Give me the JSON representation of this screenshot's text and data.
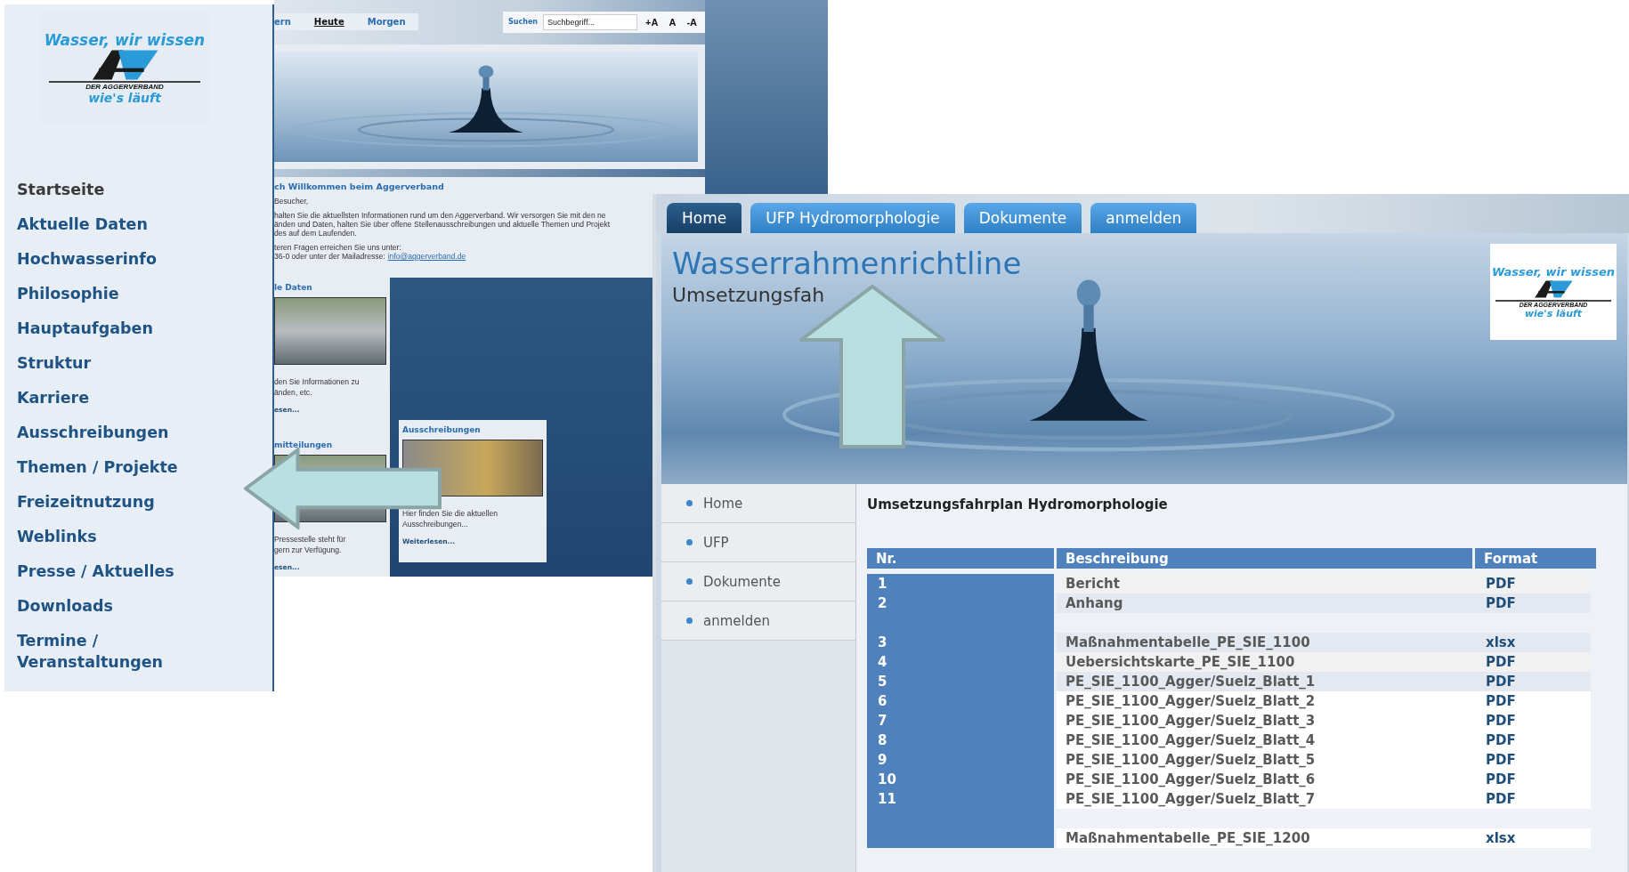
{
  "homepage": {
    "logo": {
      "top": "Wasser, wir wissen",
      "middle": "DER AGGERVERBAND",
      "bottom": "wie's läuft"
    },
    "nav": [
      {
        "label": "Startseite",
        "selected": true
      },
      {
        "label": "Aktuelle Daten",
        "selected": false
      },
      {
        "label": "Hochwasserinfo",
        "selected": false
      },
      {
        "label": "Philosophie",
        "selected": false
      },
      {
        "label": "Hauptaufgaben",
        "selected": false
      },
      {
        "label": "Struktur",
        "selected": false
      },
      {
        "label": "Karriere",
        "selected": false
      },
      {
        "label": "Ausschreibungen",
        "selected": false
      },
      {
        "label": "Themen / Projekte",
        "selected": false
      },
      {
        "label": "Freizeitnutzung",
        "selected": false
      },
      {
        "label": "Weblinks",
        "selected": false
      },
      {
        "label": "Presse / Aktuelles",
        "selected": false
      },
      {
        "label": "Downloads",
        "selected": false
      },
      {
        "label": "Termine / Veranstaltungen",
        "selected": false
      }
    ],
    "date_tabs": [
      {
        "label": "ern",
        "selected": false
      },
      {
        "label": "Heute",
        "selected": true
      },
      {
        "label": "Morgen",
        "selected": false
      }
    ],
    "search": {
      "label": "Suchen",
      "placeholder": "Suchbegriff..."
    },
    "font_size_buttons": [
      "+A",
      "A",
      "-A"
    ],
    "welcome": {
      "heading": "ch Willkommen beim Aggerverband",
      "greeting": "Besucher,",
      "lines": [
        "halten Sie die aktuellsten Informationen rund um den Aggerverband. Wir versorgen Sie mit den ne",
        "änden und Daten, halten Sie über offene Stellenausschreibungen und aktuelle Themen und Projekt",
        "des auf dem Laufenden."
      ],
      "contact": "teren Fragen erreichen Sie uns unter:",
      "contact_prefix": "36-0 oder unter der Mailadresse:",
      "email": "info@aggerverband.de"
    },
    "cards": [
      {
        "title": "le Daten",
        "lines": [
          "den Sie Informationen zu",
          "änden, etc."
        ],
        "link": "esen..."
      },
      {
        "title": "mitteilungen",
        "lines": [
          "Pressestelle steht für",
          "gern zur Verfügung."
        ],
        "link": "esen..."
      },
      {
        "title": "Ausschreibungen",
        "lines": [
          "Hier finden Sie die aktuellen",
          "Ausschreibungen..."
        ],
        "link": "Weiterlesen..."
      }
    ]
  },
  "ufp_page": {
    "tabs": [
      {
        "label": "Home",
        "selected": true
      },
      {
        "label": "UFP Hydromorphologie",
        "selected": false
      },
      {
        "label": "Dokumente",
        "selected": false
      },
      {
        "label": "anmelden",
        "selected": false
      }
    ],
    "title": "Wasserrahmenrichtline",
    "subtitle": "Umsetzungsfah",
    "logo": {
      "top": "Wasser, wir wissen",
      "middle": "DER AGGERVERBAND",
      "bottom": "wie's läuft"
    },
    "side_nav": [
      "Home",
      "UFP",
      "Dokumente",
      "anmelden"
    ],
    "heading": "Umsetzungsfahrplan Hydromorphologie",
    "table": {
      "columns": [
        "Nr.",
        "Beschreibung",
        "Format"
      ],
      "rows": [
        {
          "kind": "file",
          "nr": "1",
          "description": "Bericht",
          "format": "PDF"
        },
        {
          "kind": "file",
          "nr": "2",
          "description": "Anhang",
          "format": "PDF"
        },
        {
          "kind": "gap"
        },
        {
          "kind": "file",
          "nr": "3",
          "description": "Maßnahmentabelle_PE_SIE_1100",
          "format": "xlsx"
        },
        {
          "kind": "file",
          "nr": "4",
          "description": "Uebersichtskarte_PE_SIE_1100",
          "format": "PDF"
        },
        {
          "kind": "file",
          "nr": "5",
          "description": "PE_SIE_1100_Agger/Suelz_Blatt_1",
          "format": "PDF"
        },
        {
          "kind": "file",
          "nr": "6",
          "description": "PE_SIE_1100_Agger/Suelz_Blatt_2",
          "format": "PDF"
        },
        {
          "kind": "file",
          "nr": "7",
          "description": "PE_SIE_1100_Agger/Suelz_Blatt_3",
          "format": "PDF"
        },
        {
          "kind": "file",
          "nr": "8",
          "description": "PE_SIE_1100_Agger/Suelz_Blatt_4",
          "format": "PDF"
        },
        {
          "kind": "file",
          "nr": "9",
          "description": "PE_SIE_1100_Agger/Suelz_Blatt_5",
          "format": "PDF"
        },
        {
          "kind": "file",
          "nr": "10",
          "description": "PE_SIE_1100_Agger/Suelz_Blatt_6",
          "format": "PDF"
        },
        {
          "kind": "file",
          "nr": "11",
          "description": "PE_SIE_1100_Agger/Suelz_Blatt_7",
          "format": "PDF"
        },
        {
          "kind": "gap"
        },
        {
          "kind": "file",
          "description": "Maßnahmentabelle_PE_SIE_1200",
          "format": "xlsx"
        }
      ]
    }
  }
}
